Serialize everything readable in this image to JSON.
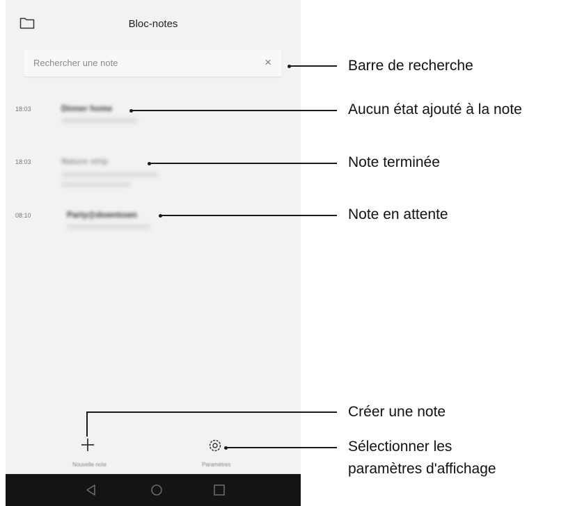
{
  "app": {
    "title": "Bloc-notes",
    "folder_icon": "folder-icon"
  },
  "search": {
    "placeholder": "Rechercher une note",
    "clear_icon": "close-icon",
    "clear_glyph": "×"
  },
  "notes": [
    {
      "time": "18:03",
      "title": "Dinner home",
      "state": "none"
    },
    {
      "time": "18:03",
      "title": "Nature strip",
      "state": "done"
    },
    {
      "time": "08:10",
      "title": "Party@downtown",
      "state": "pending"
    }
  ],
  "actions": {
    "new_note_label": "Nouvelle note",
    "new_note_icon": "plus-icon",
    "settings_label": "Paramètres",
    "settings_icon": "gear-icon"
  },
  "navbar": {
    "back_icon": "back-triangle-icon",
    "home_icon": "home-circle-icon",
    "recents_icon": "recents-square-icon"
  },
  "callouts": {
    "search_bar": "Barre de recherche",
    "no_state": "Aucun état ajouté à la note",
    "done": "Note terminée",
    "pending": "Note en attente",
    "create": "Créer une note",
    "display_settings_line1": "Sélectionner les",
    "display_settings_line2": "paramètres d'affichage"
  },
  "colors": {
    "screen_bg": "#f2f2f2",
    "navbar_bg": "#141414",
    "leader": "#1a1a1a"
  }
}
